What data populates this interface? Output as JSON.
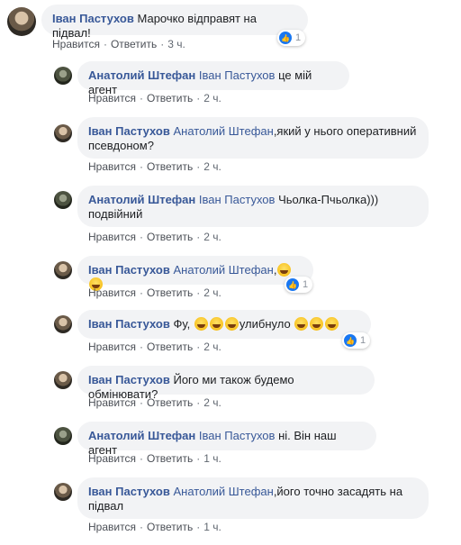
{
  "comments": [
    {
      "author": "Іван Пастухов",
      "mention": "",
      "text": "Марочко відправят на підвал!",
      "like": "Нравится",
      "reply": "Ответить",
      "time": "3 ч.",
      "reactions": "1"
    },
    {
      "author": "Анатолий Штефан",
      "mention": "Іван Пастухов",
      "text": "це мій агент",
      "like": "Нравится",
      "reply": "Ответить",
      "time": "2 ч."
    },
    {
      "author": "Іван Пастухов",
      "mention": "Анатолий Штефан",
      "text": ",який у нього оперативний",
      "text2": "псевдоном?",
      "like": "Нравится",
      "reply": "Ответить",
      "time": "2 ч."
    },
    {
      "author": "Анатолий Штефан",
      "mention": "Іван Пастухов",
      "text": "Чьолка-Пчьолка)))",
      "text2": "подвійний",
      "like": "Нравится",
      "reply": "Ответить",
      "time": "2 ч."
    },
    {
      "author": "Іван Пастухов",
      "mention": "Анатолий Штефан",
      "text": ",",
      "like": "Нравится",
      "reply": "Ответить",
      "time": "2 ч.",
      "reactions": "1",
      "emojis": [
        "rolling-on-floor-laughing",
        "rolling-on-floor-laughing"
      ]
    },
    {
      "author": "Іван Пастухов",
      "mention": "",
      "text": "Фу,",
      "text_mid": "улибнуло",
      "like": "Нравится",
      "reply": "Ответить",
      "time": "2 ч.",
      "reactions": "1",
      "emojis": [
        "grinning-squinting",
        "grinning-squinting",
        "grinning-squinting",
        "grinning-squinting",
        "grinning-squinting",
        "grinning-squinting"
      ]
    },
    {
      "author": "Іван Пастухов",
      "mention": "",
      "text": "Його ми також будемо обмінювати?",
      "like": "Нравится",
      "reply": "Ответить",
      "time": "2 ч."
    },
    {
      "author": "Анатолий Штефан",
      "mention": "Іван Пастухов",
      "text": "ні. Він наш агент",
      "like": "Нравится",
      "reply": "Ответить",
      "time": "1 ч."
    },
    {
      "author": "Іван Пастухов",
      "mention": "Анатолий Штефан",
      "text": ",його точно засадять на",
      "text2": "підвал",
      "like": "Нравится",
      "reply": "Ответить",
      "time": "1 ч."
    }
  ],
  "colors": {
    "link": "#385898",
    "bubble": "#f2f3f5",
    "like_icon": "#1877f2"
  }
}
